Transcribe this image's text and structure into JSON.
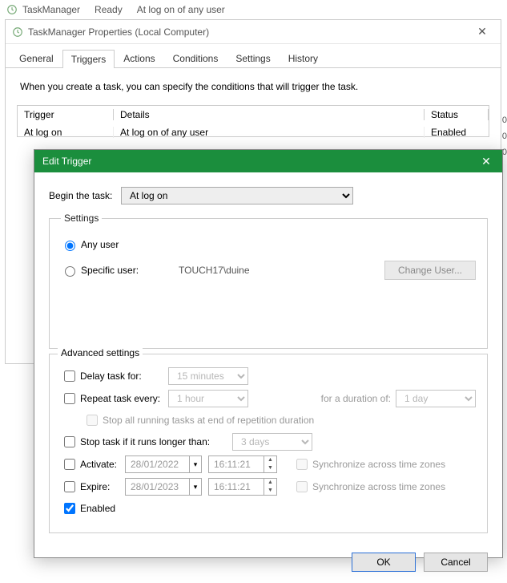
{
  "topbar": {
    "app": "TaskManager",
    "state": "Ready",
    "trigger_summary": "At log on of any user"
  },
  "prop_window": {
    "title": "TaskManager Properties (Local Computer)",
    "tabs": [
      "General",
      "Triggers",
      "Actions",
      "Conditions",
      "Settings",
      "History"
    ],
    "active_tab": "Triggers",
    "intro": "When you create a task, you can specify the conditions that will trigger the task.",
    "columns": {
      "trigger": "Trigger",
      "details": "Details",
      "status": "Status"
    },
    "row": {
      "trigger": "At log on",
      "details": "At log on of any user",
      "status": "Enabled"
    }
  },
  "dlg": {
    "title": "Edit Trigger",
    "begin_label": "Begin the task:",
    "begin_value": "At log on",
    "settings_legend": "Settings",
    "any_user": "Any user",
    "specific_user": "Specific user:",
    "specific_user_value": "TOUCH17\\duine",
    "change_user_btn": "Change User...",
    "adv_legend": "Advanced settings",
    "delay_label": "Delay task for:",
    "delay_value": "15 minutes",
    "repeat_label": "Repeat task every:",
    "repeat_value": "1 hour",
    "duration_label": "for a duration of:",
    "duration_value": "1 day",
    "stop_all_label": "Stop all running tasks at end of repetition duration",
    "stop_if_label": "Stop task if it runs longer than:",
    "stop_if_value": "3 days",
    "activate_label": "Activate:",
    "activate_date": "28/01/2022",
    "activate_time": "16:11:21",
    "expire_label": "Expire:",
    "expire_date": "28/01/2023",
    "expire_time": "16:11:21",
    "sync_label": "Synchronize across time zones",
    "enabled_label": "Enabled",
    "ok": "OK",
    "cancel": "Cancel"
  },
  "edge": [
    "0",
    "0",
    "0"
  ]
}
